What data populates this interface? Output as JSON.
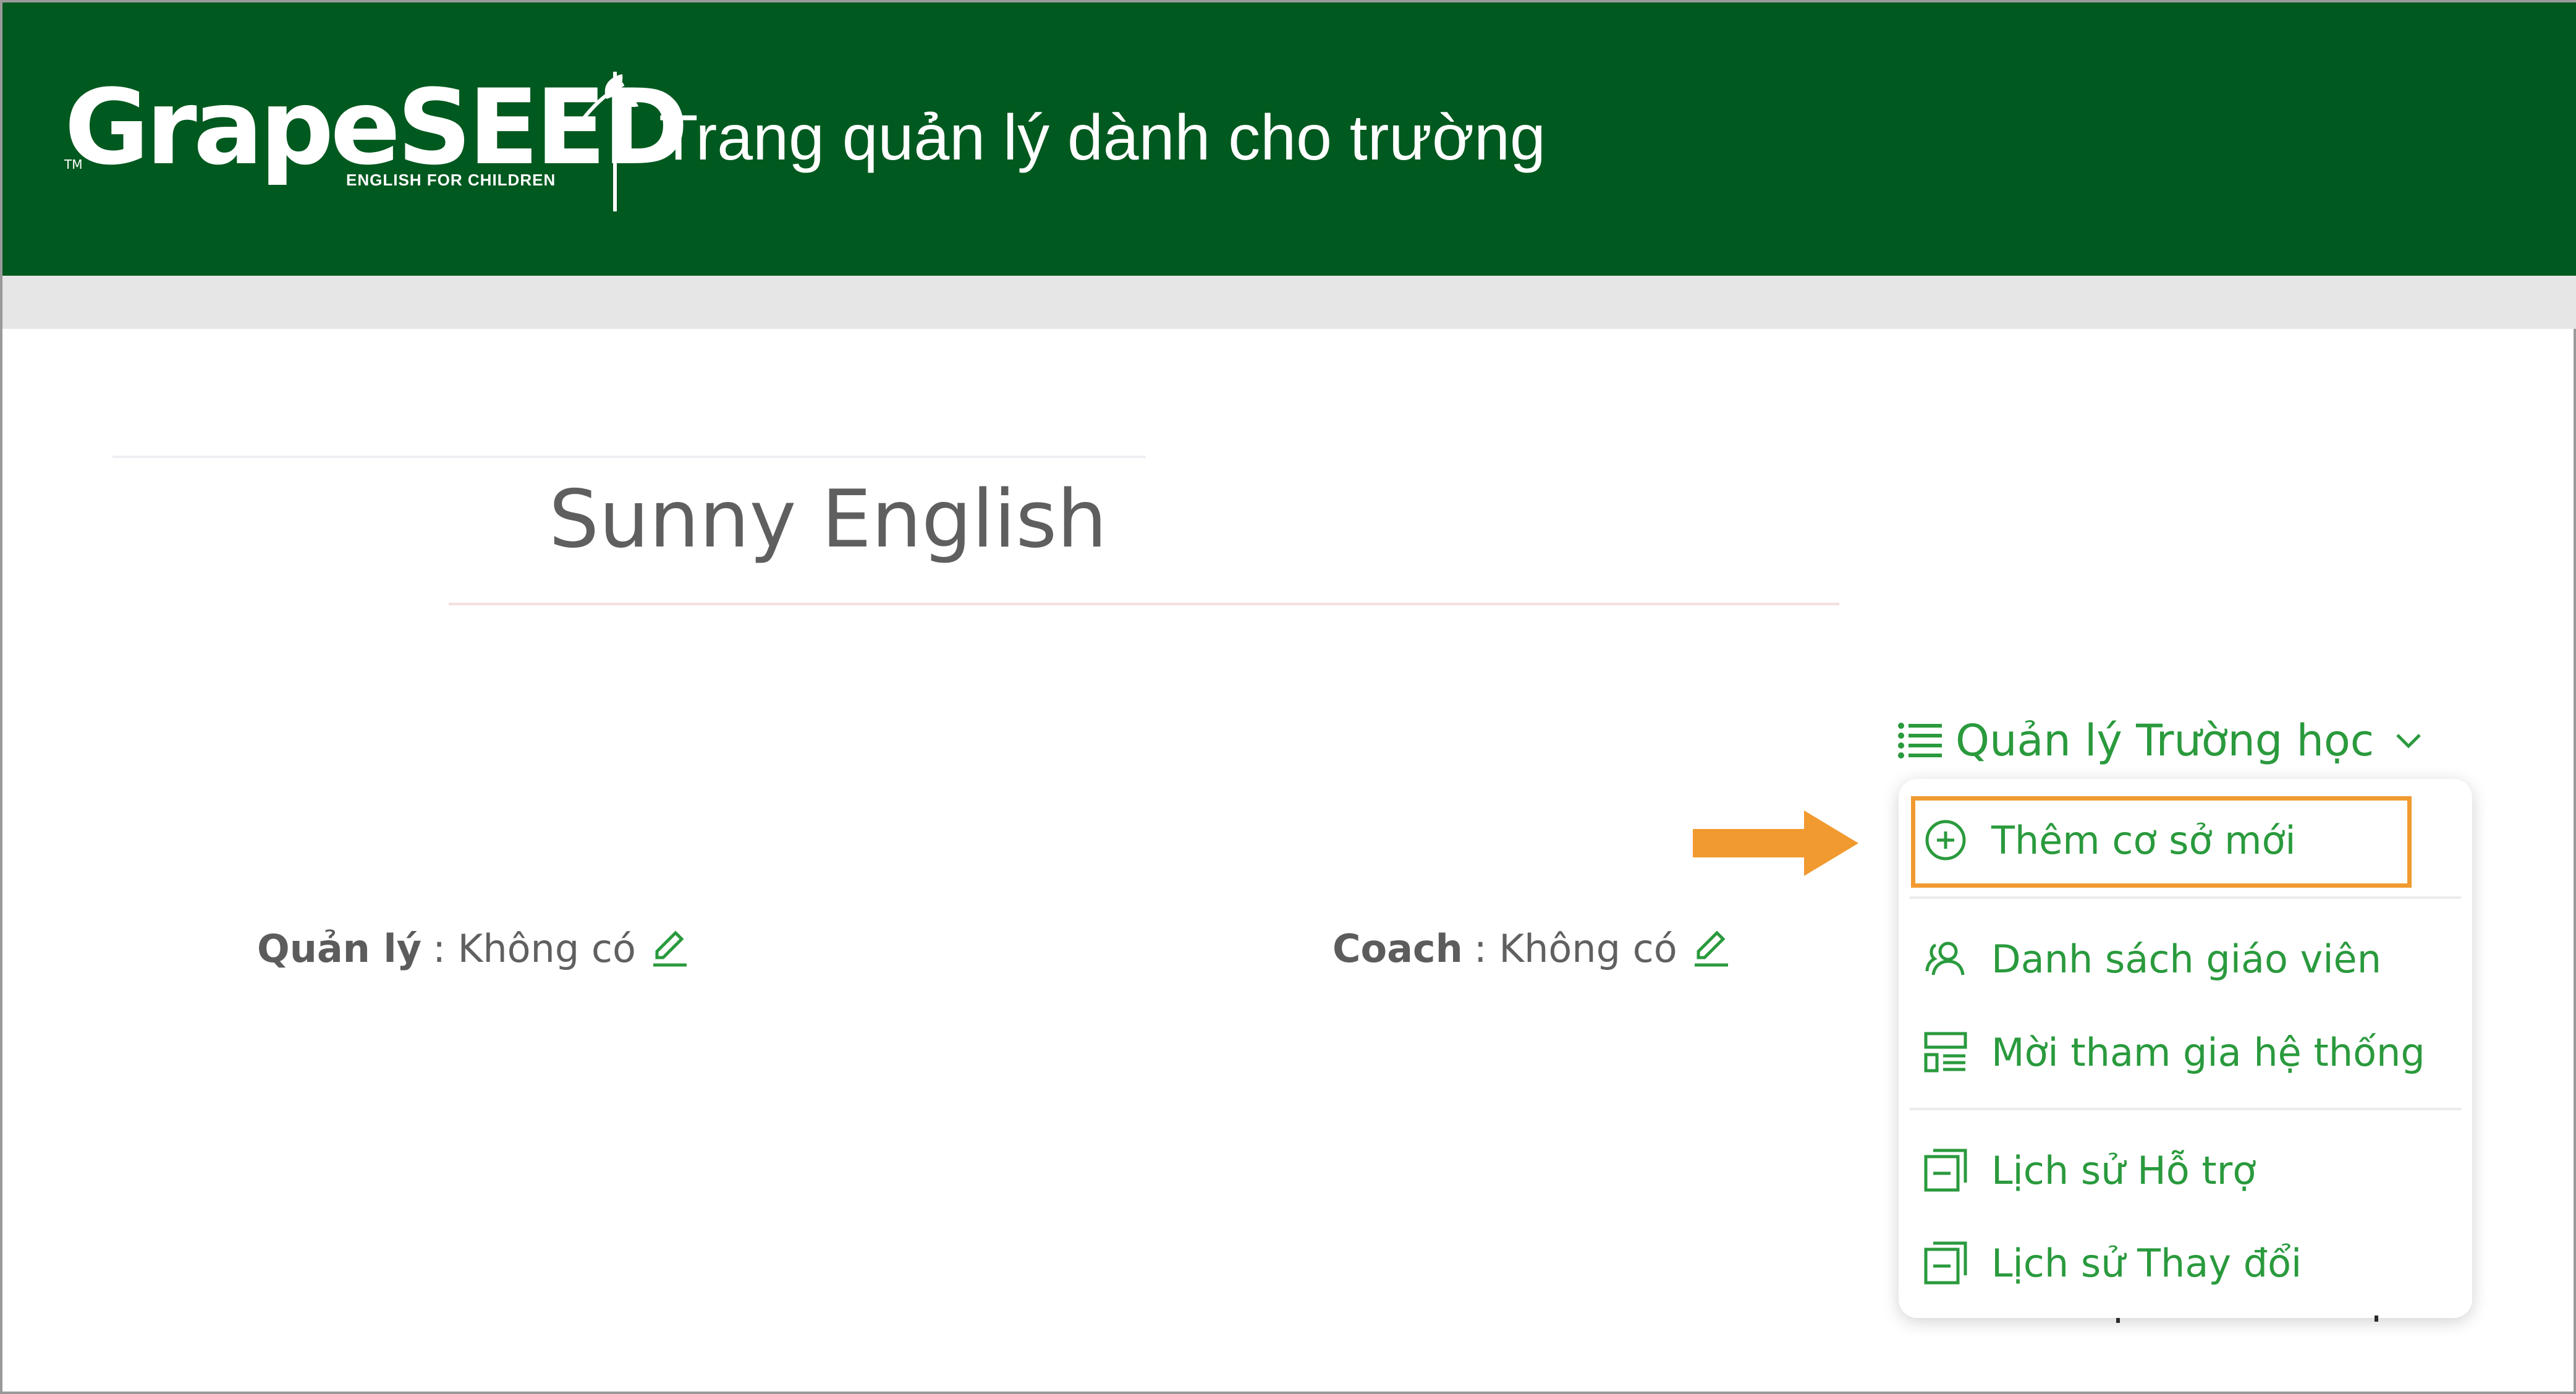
{
  "header": {
    "logo_text": "GrapeSEED",
    "logo_tm": "TM",
    "logo_tagline": "ENGLISH FOR CHILDREN",
    "title": "Trang quản lý dành cho trường",
    "bg_color": "#00591f"
  },
  "school": {
    "name": "Sunny English"
  },
  "menu": {
    "trigger_icon": "list-icon",
    "trigger_label": "Quản lý Trường học",
    "chevron_icon": "chevron-down-icon",
    "accent_color": "#2a9a3d",
    "items": [
      {
        "label": "Thêm cơ sở mới",
        "icon": "plus-circle-icon",
        "highlighted": true
      },
      {
        "label": "Danh sách giáo viên",
        "icon": "users-icon"
      },
      {
        "label": "Mời tham gia hệ thống",
        "icon": "invite-list-icon"
      },
      {
        "label": "Lịch sử Hỗ trợ",
        "icon": "history-icon"
      },
      {
        "label": "Lịch sử Thay đổi",
        "icon": "history-icon"
      }
    ]
  },
  "info": {
    "manager_label": "Quản lý",
    "manager_value": ": Không có",
    "coach_label": "Coach",
    "coach_value": ": Không có",
    "edit_icon": "pencil-icon"
  },
  "annotation": {
    "arrow_color": "#f19a30",
    "box_color": "#f19a30"
  }
}
